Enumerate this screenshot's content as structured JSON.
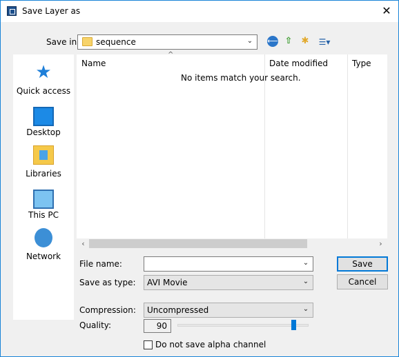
{
  "window": {
    "title": "Save Layer as",
    "close_glyph": "✕"
  },
  "save_in": {
    "label": "Save in:",
    "folder": "sequence"
  },
  "toolbar": {
    "back_glyph": "⟵",
    "up_glyph": "⇧",
    "new_folder_glyph": "✱",
    "view_glyph": "☰▾"
  },
  "places": [
    {
      "label": "Quick access",
      "icon": "star-icon"
    },
    {
      "label": "Desktop",
      "icon": "desktop-icon"
    },
    {
      "label": "Libraries",
      "icon": "libraries-icon"
    },
    {
      "label": "This PC",
      "icon": "computer-icon"
    },
    {
      "label": "Network",
      "icon": "network-icon"
    }
  ],
  "file_list": {
    "columns": [
      "Name",
      "Date modified",
      "Type"
    ],
    "empty_message": "No items match your search."
  },
  "form": {
    "file_name_label": "File name:",
    "file_name_value": "",
    "save_as_type_label": "Save as type:",
    "save_as_type_value": "AVI Movie",
    "compression_label": "Compression:",
    "compression_value": "Uncompressed",
    "quality_label": "Quality:",
    "quality_value": "90",
    "quality_slider_fraction": 0.9,
    "alpha_checkbox_label": "Do not save alpha channel",
    "alpha_checked": false
  },
  "buttons": {
    "save": "Save",
    "cancel": "Cancel"
  },
  "colors": {
    "accent": "#0078d7",
    "list_bg": "#ffffff",
    "dialog_bg": "#f0f0f0"
  }
}
